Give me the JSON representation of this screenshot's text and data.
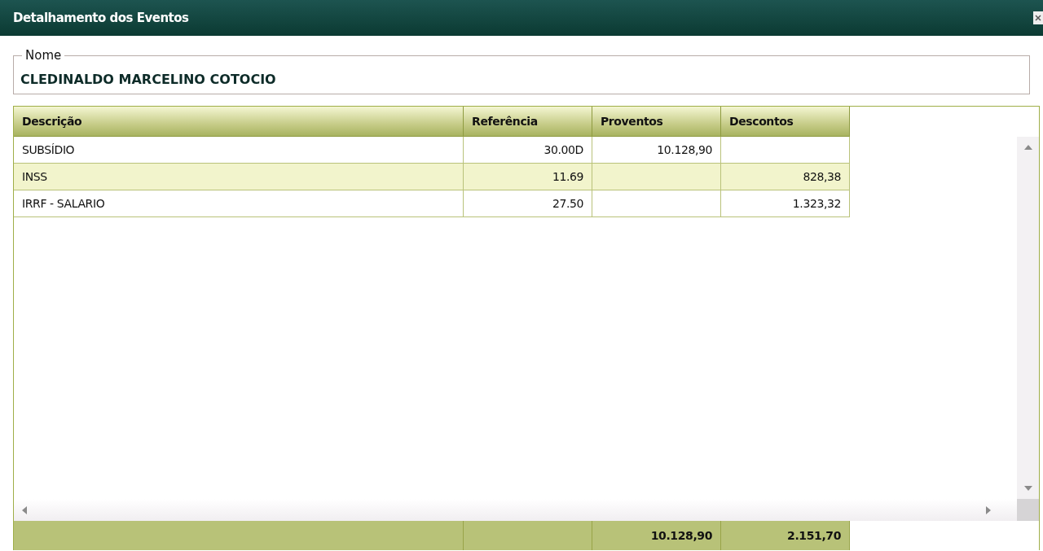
{
  "window": {
    "title": "Detalhamento dos Eventos"
  },
  "name_group": {
    "legend": "Nome",
    "value": "CLEDINALDO MARCELINO COTOCIO"
  },
  "table": {
    "columns": [
      "Descrição",
      "Referência",
      "Proventos",
      "Descontos"
    ],
    "rows": [
      {
        "cells": [
          "SUBSÍDIO",
          "30.00D",
          "10.128,90",
          ""
        ],
        "selected": false
      },
      {
        "cells": [
          "INSS",
          "11.69",
          "",
          "828,38"
        ],
        "selected": true
      },
      {
        "cells": [
          "IRRF - SALARIO",
          "27.50",
          "",
          "1.323,32"
        ],
        "selected": false
      }
    ],
    "totals": {
      "proventos": "10.128,90",
      "descontos": "2.151,70"
    }
  }
}
